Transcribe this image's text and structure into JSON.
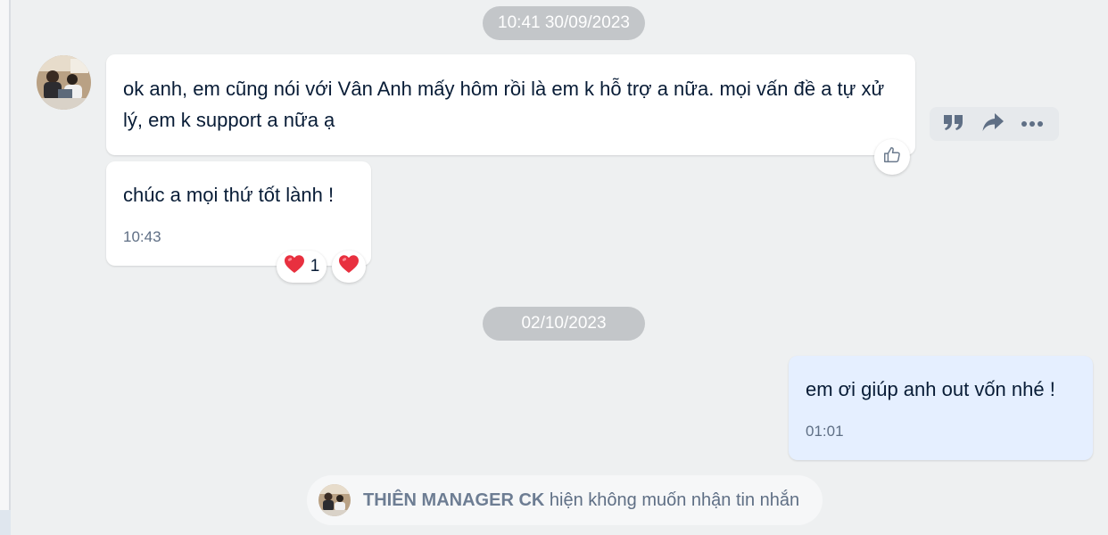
{
  "chat": {
    "date_separator_1": "10:41 30/09/2023",
    "date_separator_2": "02/10/2023",
    "messages": [
      {
        "text": "ok anh, em cũng nói với Vân Anh mấy hôm rồi là em k hỗ trợ a nữa. mọi vấn đề a tự xử lý, em k support a nữa ạ",
        "sender": "other"
      },
      {
        "text": "chúc a mọi thứ tốt lành !",
        "time": "10:43",
        "sender": "other",
        "reaction_count": "1"
      },
      {
        "text": "em ơi giúp anh out vốn nhé !",
        "time": "01:01",
        "sender": "me"
      }
    ],
    "notice": {
      "sender_name": "THIÊN MANAGER CK",
      "message": " hiện không muốn nhận tin nhắn"
    }
  },
  "icons": {
    "like": "thumbs-up-icon",
    "quote": "quote-icon",
    "forward": "forward-icon",
    "more": "more-dots-icon",
    "reaction": "heart-icon"
  },
  "colors": {
    "background": "#eef0f1",
    "bubble_other": "#ffffff",
    "bubble_me": "#e5efff",
    "date_pill": "#c3c6c9",
    "heart": "#e8303f",
    "icon": "#5f6f85"
  }
}
